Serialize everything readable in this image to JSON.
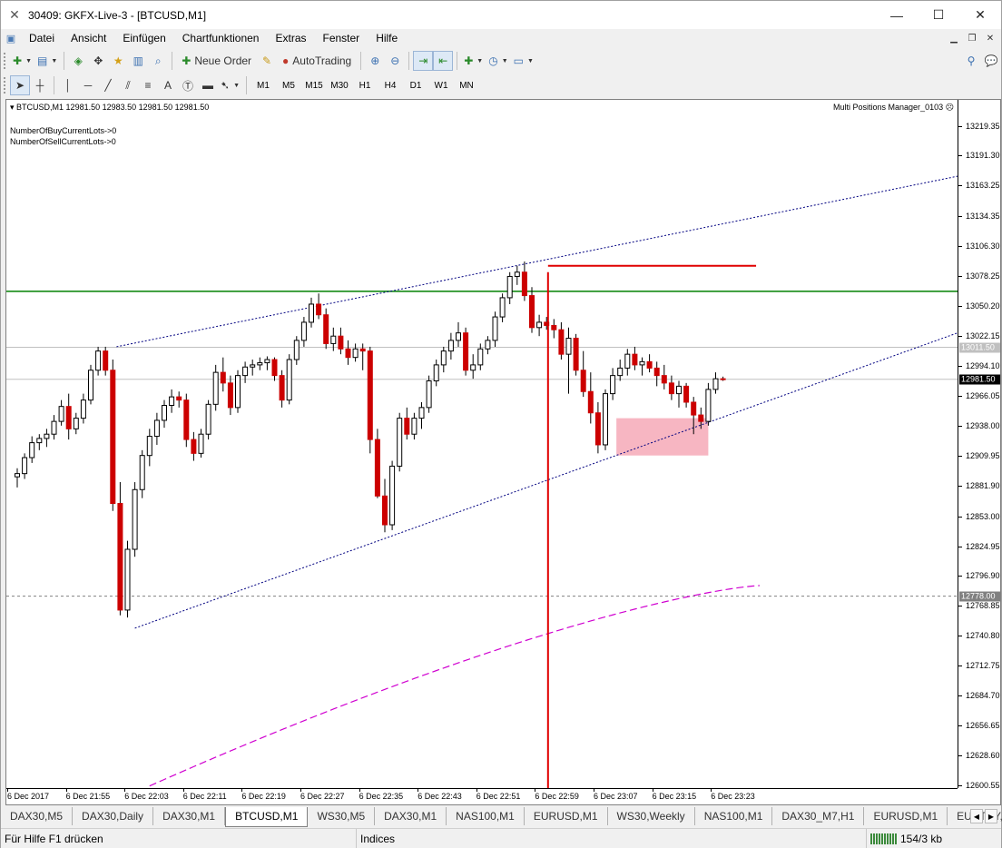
{
  "window": {
    "title": "30409: GKFX-Live-3 - [BTCUSD,M1]"
  },
  "menu": [
    "Datei",
    "Ansicht",
    "Einfügen",
    "Chartfunktionen",
    "Extras",
    "Fenster",
    "Hilfe"
  ],
  "toolbar": {
    "new_order": "Neue Order",
    "autotrading": "AutoTrading"
  },
  "timeframes": [
    "M1",
    "M5",
    "M15",
    "M30",
    "H1",
    "H4",
    "D1",
    "W1",
    "MN"
  ],
  "chart_data": {
    "type": "candlestick",
    "header": "BTCUSD,M1  12981.50 12983.50 12981.50 12981.50",
    "indicator_name": "Multi Positions Manager_0103",
    "overlay_lines": [
      "NumberOfBuyCurrentLots->0",
      "NumberOfSellCurrentLots->0"
    ],
    "ylim": [
      12600.55,
      13219.35
    ],
    "y_ticks": [
      "13219.35",
      "13191.30",
      "13163.25",
      "13134.35",
      "13106.30",
      "13078.25",
      "13050.20",
      "13022.15",
      "12994.10",
      "12966.05",
      "12938.00",
      "12909.95",
      "12881.90",
      "12853.00",
      "12824.95",
      "12796.90",
      "12768.85",
      "12740.80",
      "12712.75",
      "12684.70",
      "12656.65",
      "12628.60",
      "12600.55"
    ],
    "x_ticks": [
      "6 Dec 2017",
      "6 Dec 21:55",
      "6 Dec 22:03",
      "6 Dec 22:11",
      "6 Dec 22:19",
      "6 Dec 22:27",
      "6 Dec 22:35",
      "6 Dec 22:43",
      "6 Dec 22:51",
      "6 Dec 22:59",
      "6 Dec 23:07",
      "6 Dec 23:15",
      "6 Dec 23:23"
    ],
    "price_badges": [
      {
        "label": "13011.50",
        "value": 13011.5,
        "bg": "#c0c0c0",
        "fg": "#ffffff"
      },
      {
        "label": "12981.50",
        "value": 12981.5,
        "bg": "#000000",
        "fg": "#ffffff"
      },
      {
        "label": "12778.00",
        "value": 12778.0,
        "bg": "#808080",
        "fg": "#ffffff"
      }
    ],
    "horizontal_lines": [
      {
        "value": 13064,
        "color": "#008000",
        "style": "solid"
      },
      {
        "value": 13011.5,
        "color": "#c0c0c0",
        "style": "solid"
      },
      {
        "value": 12981.5,
        "color": "#c0c0c0",
        "style": "solid"
      },
      {
        "value": 12778,
        "color": "#808080",
        "style": "dashed"
      }
    ],
    "candles": [
      [
        12890,
        12898,
        12880,
        12893
      ],
      [
        12893,
        12912,
        12888,
        12908
      ],
      [
        12908,
        12928,
        12903,
        12922
      ],
      [
        12922,
        12930,
        12915,
        12926
      ],
      [
        12926,
        12935,
        12918,
        12930
      ],
      [
        12930,
        12948,
        12925,
        12942
      ],
      [
        12942,
        12962,
        12938,
        12956
      ],
      [
        12956,
        12968,
        12925,
        12935
      ],
      [
        12935,
        12950,
        12930,
        12945
      ],
      [
        12945,
        12968,
        12940,
        12962
      ],
      [
        12962,
        12995,
        12958,
        12990
      ],
      [
        12990,
        13012,
        12985,
        13008
      ],
      [
        13008,
        13012,
        12985,
        12990
      ],
      [
        12990,
        13000,
        12858,
        12865
      ],
      [
        12865,
        12885,
        12760,
        12765
      ],
      [
        12765,
        12830,
        12758,
        12822
      ],
      [
        12822,
        12885,
        12815,
        12878
      ],
      [
        12878,
        12915,
        12870,
        12910
      ],
      [
        12910,
        12935,
        12900,
        12928
      ],
      [
        12928,
        12950,
        12920,
        12943
      ],
      [
        12943,
        12962,
        12936,
        12957
      ],
      [
        12957,
        12972,
        12950,
        12965
      ],
      [
        12965,
        12970,
        12955,
        12962
      ],
      [
        12962,
        12968,
        12918,
        12925
      ],
      [
        12925,
        12932,
        12905,
        12912
      ],
      [
        12912,
        12935,
        12908,
        12930
      ],
      [
        12930,
        12962,
        12925,
        12958
      ],
      [
        12958,
        12995,
        12952,
        12988
      ],
      [
        12988,
        13002,
        12970,
        12978
      ],
      [
        12978,
        12985,
        12948,
        12955
      ],
      [
        12955,
        12990,
        12950,
        12985
      ],
      [
        12985,
        12998,
        12978,
        12993
      ],
      [
        12993,
        13000,
        12985,
        12995
      ],
      [
        12995,
        13002,
        12990,
        12997
      ],
      [
        12997,
        13003,
        12990,
        13000
      ],
      [
        13000,
        13002,
        12980,
        12985
      ],
      [
        12985,
        12990,
        12955,
        12962
      ],
      [
        12962,
        13005,
        12958,
        13000
      ],
      [
        13000,
        13022,
        12995,
        13018
      ],
      [
        13018,
        13040,
        13012,
        13035
      ],
      [
        13035,
        13058,
        13030,
        13052
      ],
      [
        13052,
        13062,
        13038,
        13042
      ],
      [
        13042,
        13048,
        13010,
        13015
      ],
      [
        13015,
        13030,
        13008,
        13022
      ],
      [
        13022,
        13030,
        13005,
        13010
      ],
      [
        13010,
        13018,
        12995,
        13002
      ],
      [
        13002,
        13015,
        12998,
        13010
      ],
      [
        13010,
        13015,
        12990,
        13008
      ],
      [
        13008,
        13012,
        12912,
        12925
      ],
      [
        12925,
        12935,
        12870,
        12872
      ],
      [
        12872,
        12888,
        12838,
        12845
      ],
      [
        12845,
        12905,
        12840,
        12900
      ],
      [
        12900,
        12950,
        12895,
        12945
      ],
      [
        12945,
        12955,
        12925,
        12930
      ],
      [
        12930,
        12950,
        12925,
        12945
      ],
      [
        12945,
        12960,
        12935,
        12955
      ],
      [
        12955,
        12985,
        12950,
        12980
      ],
      [
        12980,
        13000,
        12975,
        12995
      ],
      [
        12995,
        13012,
        12988,
        13008
      ],
      [
        13008,
        13025,
        13000,
        13018
      ],
      [
        13018,
        13035,
        13012,
        13025
      ],
      [
        13025,
        13030,
        12985,
        12990
      ],
      [
        12990,
        13005,
        12982,
        12995
      ],
      [
        12995,
        13015,
        12990,
        13010
      ],
      [
        13010,
        13022,
        13005,
        13018
      ],
      [
        13018,
        13045,
        13012,
        13040
      ],
      [
        13040,
        13062,
        13035,
        13058
      ],
      [
        13058,
        13082,
        13052,
        13078
      ],
      [
        13078,
        13088,
        13070,
        13082
      ],
      [
        13082,
        13092,
        13055,
        13060
      ],
      [
        13060,
        13068,
        13025,
        13030
      ],
      [
        13030,
        13042,
        13022,
        13035
      ],
      [
        13035,
        13040,
        13028,
        13032
      ],
      [
        13032,
        13038,
        13020,
        13028
      ],
      [
        13028,
        13035,
        13000,
        13005
      ],
      [
        13005,
        13030,
        12968,
        13020
      ],
      [
        13020,
        13024,
        12985,
        12990
      ],
      [
        12990,
        13008,
        12965,
        12970
      ],
      [
        12970,
        12988,
        12940,
        12950
      ],
      [
        12950,
        12960,
        12912,
        12920
      ],
      [
        12920,
        12972,
        12915,
        12968
      ],
      [
        12968,
        12992,
        12962,
        12985
      ],
      [
        12985,
        13000,
        12980,
        12992
      ],
      [
        12992,
        13010,
        12985,
        13005
      ],
      [
        13005,
        13012,
        12990,
        12995
      ],
      [
        12995,
        13002,
        12985,
        12998
      ],
      [
        12998,
        13005,
        12988,
        12992
      ],
      [
        12992,
        12998,
        12975,
        12985
      ],
      [
        12985,
        12995,
        12972,
        12978
      ],
      [
        12978,
        12985,
        12962,
        12968
      ],
      [
        12968,
        12980,
        12955,
        12975
      ],
      [
        12975,
        12978,
        12955,
        12960
      ],
      [
        12960,
        12965,
        12930,
        12948
      ],
      [
        12948,
        12955,
        12935,
        12942
      ],
      [
        12942,
        12978,
        12938,
        12972
      ],
      [
        12972,
        12988,
        12968,
        12982
      ],
      [
        12982,
        12984,
        12980,
        12981.5
      ]
    ]
  },
  "tabs": [
    "DAX30,M5",
    "DAX30,Daily",
    "DAX30,M1",
    "BTCUSD,M1",
    "WS30,M5",
    "DAX30,M1",
    "NAS100,M1",
    "EURUSD,M1",
    "WS30,Weekly",
    "NAS100,M1",
    "DAX30_M7,H1",
    "EURUSD,M1",
    "EURTRY,I"
  ],
  "active_tab_index": 3,
  "status": {
    "help": "Für Hilfe F1 drücken",
    "profile": "Indices",
    "traffic": "154/3 kb"
  }
}
